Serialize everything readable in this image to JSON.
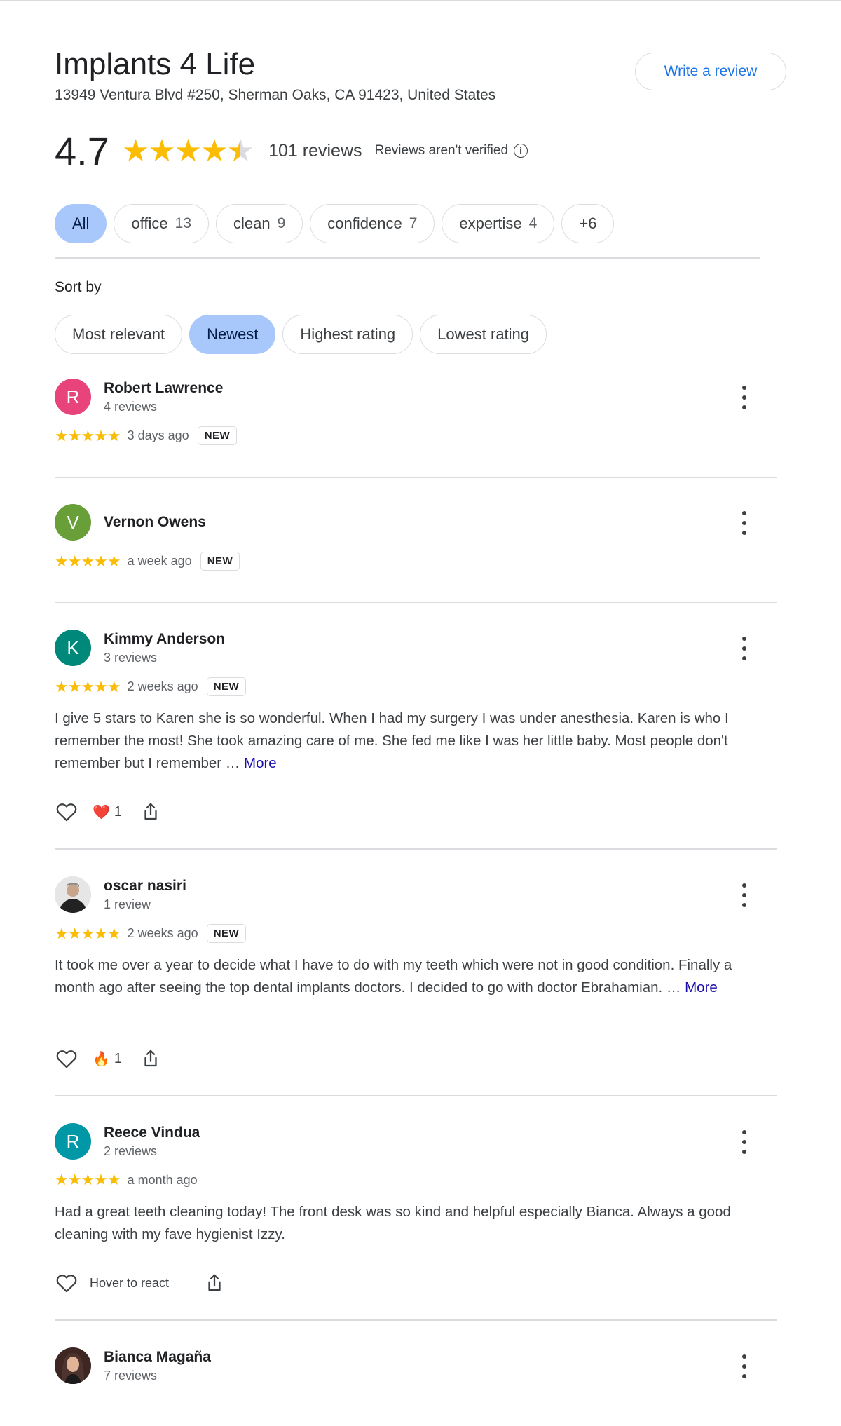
{
  "place": {
    "name": "Implants 4 Life",
    "address": "13949 Ventura Blvd #250, Sherman Oaks, CA 91423, United States",
    "write_review": "Write a review"
  },
  "summary": {
    "rating": "4.7",
    "rating_value": 4.7,
    "reviews": "101 reviews",
    "unverified": "Reviews aren't verified",
    "info_icon": "i"
  },
  "topic_chips": [
    {
      "label": "All",
      "count": ""
    },
    {
      "label": "office",
      "count": "13"
    },
    {
      "label": "clean",
      "count": "9"
    },
    {
      "label": "confidence",
      "count": "7"
    },
    {
      "label": "expertise",
      "count": "4"
    },
    {
      "label": "+6",
      "count": ""
    }
  ],
  "sort": {
    "label": "Sort by",
    "options": [
      "Most relevant",
      "Newest",
      "Highest rating",
      "Lowest rating"
    ],
    "selected": "Newest"
  },
  "reviews": [
    {
      "name": "Robert Lawrence",
      "sub": "4 reviews",
      "initial": "R",
      "avatar_color": "#e8437b",
      "stars": "★★★★★",
      "date": "3 days ago",
      "badge": "NEW"
    },
    {
      "name": "Vernon Owens",
      "sub": "",
      "initial": "V",
      "avatar_color": "#689f38",
      "stars": "★★★★★",
      "date": "a week ago",
      "badge": "NEW"
    },
    {
      "name": "Kimmy Anderson",
      "sub": "3 reviews",
      "initial": "K",
      "avatar_color": "#00897b",
      "stars": "★★★★★",
      "date": "2 weeks ago",
      "badge": "NEW",
      "text": "I give 5 stars to Karen she is so wonderful. When I had my surgery I was under anesthesia. Karen is who I remember the most! She took amazing care of me. She fed me like I was her little baby. Most people don't remember but I remember … ",
      "more": "More",
      "reaction_emoji": "❤️",
      "reaction_count": "1"
    },
    {
      "name": "oscar nasiri",
      "sub": "1 review",
      "initial": "",
      "avatar_color": "#cfcfcf",
      "stars": "★★★★★",
      "date": "2 weeks ago",
      "badge": "NEW",
      "text": "It took me over a year to decide what I have to do with my teeth which were not in good condition. Finally a month ago after seeing the top dental implants doctors. I decided to go with doctor Ebrahamian. … ",
      "more": "More",
      "reaction_emoji": "🔥",
      "reaction_count": "1"
    },
    {
      "name": "Reece Vindua",
      "sub": "2 reviews",
      "initial": "R",
      "avatar_color": "#0097a7",
      "stars": "★★★★★",
      "date": "a month ago",
      "badge": "",
      "text": "Had a great teeth cleaning today! The front desk was so kind and helpful especially Bianca. Always a good cleaning with my fave hygienist Izzy.",
      "hover": "Hover to react"
    },
    {
      "name": "Bianca Magaña",
      "sub": "7 reviews",
      "initial": "",
      "avatar_color": "#6d4c41"
    }
  ]
}
